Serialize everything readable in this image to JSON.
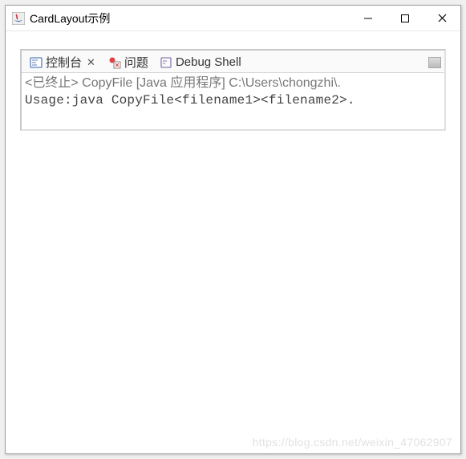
{
  "window": {
    "title": "CardLayout示例"
  },
  "tabs": {
    "console": "控制台",
    "problems": "问题",
    "debug": "Debug Shell"
  },
  "output": {
    "status": "<已终止> CopyFile [Java 应用程序] C:\\Users\\chongzhi\\.",
    "line1": "Usage:java CopyFile<filename1><filename2>."
  },
  "watermark": "https://blog.csdn.net/weixin_47062907"
}
